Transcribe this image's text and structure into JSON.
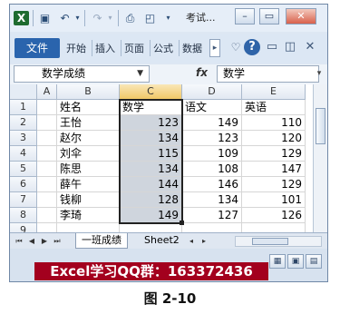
{
  "title": "考试...",
  "ribbon": {
    "file_tab": "文件",
    "tabs": [
      "开始",
      "插入",
      "页面",
      "公式",
      "数据"
    ]
  },
  "formula_bar": {
    "name_box_value": "数学成绩",
    "fx_label": "fx",
    "formula_value": "数学"
  },
  "columns": [
    "A",
    "B",
    "C",
    "D",
    "E"
  ],
  "rows": [
    "1",
    "2",
    "3",
    "4",
    "5",
    "6",
    "7",
    "8",
    "9"
  ],
  "table": {
    "headers": [
      "姓名",
      "数学",
      "语文",
      "英语"
    ],
    "data": [
      [
        "王怡",
        "123",
        "149",
        "110"
      ],
      [
        "赵尔",
        "134",
        "123",
        "120"
      ],
      [
        "刘伞",
        "115",
        "109",
        "129"
      ],
      [
        "陈思",
        "134",
        "108",
        "147"
      ],
      [
        "薛午",
        "144",
        "146",
        "129"
      ],
      [
        "钱柳",
        "128",
        "134",
        "101"
      ],
      [
        "李琦",
        "149",
        "127",
        "126"
      ]
    ]
  },
  "sheets": [
    "一班成绩",
    "Sheet2"
  ],
  "watermark": "Excel学习QQ群：163372436",
  "caption": "图 2-10",
  "colors": {
    "file_tab": "#2a64ad",
    "selection_fill": "#cfd5dd",
    "selected_col_header": "#f1c867",
    "watermark_bg": "#a3001e"
  },
  "icons": [
    "excel-logo-icon",
    "save-icon",
    "undo-icon",
    "redo-icon",
    "print-icon",
    "customize-icon",
    "minimize-icon",
    "restore-icon",
    "close-icon",
    "help-icon",
    "ribbon-minimize-icon",
    "chevron-down-icon",
    "heart-icon"
  ]
}
